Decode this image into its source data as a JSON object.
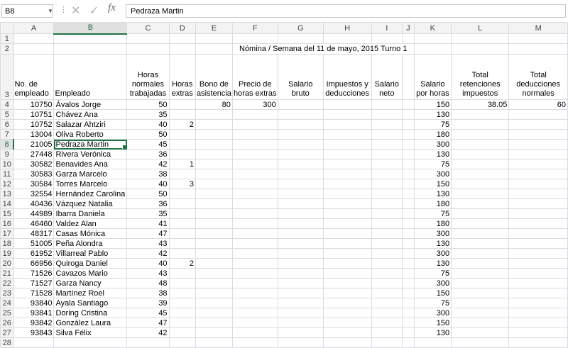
{
  "formula_bar": {
    "name_box": "B8",
    "formula": "Pedraza Martin",
    "fx_label": "fx",
    "dots": "⋮",
    "cancel_icon": "✕",
    "enter_icon": "✓"
  },
  "columns": [
    "A",
    "B",
    "C",
    "D",
    "E",
    "F",
    "G",
    "H",
    "I",
    "J",
    "K",
    "L",
    "M"
  ],
  "title": "Nómina / Semana del 11 de mayo, 2015 Turno 1",
  "headers": {
    "a": "No. de empleado",
    "b": "Empleado",
    "c": "Horas normales trabajadas",
    "d": "Horas extras",
    "e": "Bono de asistencia",
    "f": "Precio de horas extras",
    "g": "Salario bruto",
    "h": "Impuestos y deducciones",
    "i": "Salario neto",
    "k": "Salario por horas",
    "l": "Total retenciones impuestos",
    "m": "Total deducciones normales"
  },
  "rows": [
    {
      "id": "10750",
      "name": "Ávalos Jorge",
      "hours": "50",
      "extra": "",
      "bono": "80",
      "precio": "300",
      "rate": "150",
      "ret": "38.05",
      "ded": "60"
    },
    {
      "id": "10751",
      "name": "Chávez Ana",
      "hours": "35",
      "extra": "",
      "bono": "",
      "precio": "",
      "rate": "130",
      "ret": "",
      "ded": ""
    },
    {
      "id": "10752",
      "name": "Salazar Ahtziri",
      "hours": "40",
      "extra": "2",
      "bono": "",
      "precio": "",
      "rate": "75",
      "ret": "",
      "ded": ""
    },
    {
      "id": "13004",
      "name": "Oliva Roberto",
      "hours": "50",
      "extra": "",
      "bono": "",
      "precio": "",
      "rate": "180",
      "ret": "",
      "ded": ""
    },
    {
      "id": "21005",
      "name": "Pedraza Martin",
      "hours": "45",
      "extra": "",
      "bono": "",
      "precio": "",
      "rate": "300",
      "ret": "",
      "ded": ""
    },
    {
      "id": "27448",
      "name": "Rivera Verónica",
      "hours": "36",
      "extra": "",
      "bono": "",
      "precio": "",
      "rate": "130",
      "ret": "",
      "ded": ""
    },
    {
      "id": "30582",
      "name": "Benavides Ana",
      "hours": "42",
      "extra": "1",
      "bono": "",
      "precio": "",
      "rate": "75",
      "ret": "",
      "ded": ""
    },
    {
      "id": "30583",
      "name": "Garza Marcelo",
      "hours": "38",
      "extra": "",
      "bono": "",
      "precio": "",
      "rate": "300",
      "ret": "",
      "ded": ""
    },
    {
      "id": "30584",
      "name": "Torres Marcelo",
      "hours": "40",
      "extra": "3",
      "bono": "",
      "precio": "",
      "rate": "150",
      "ret": "",
      "ded": ""
    },
    {
      "id": "32554",
      "name": "Hernández Carolina",
      "hours": "50",
      "extra": "",
      "bono": "",
      "precio": "",
      "rate": "130",
      "ret": "",
      "ded": ""
    },
    {
      "id": "40436",
      "name": "Vázquez Natalia",
      "hours": "36",
      "extra": "",
      "bono": "",
      "precio": "",
      "rate": "180",
      "ret": "",
      "ded": ""
    },
    {
      "id": "44989",
      "name": "Ibarra Daniela",
      "hours": "35",
      "extra": "",
      "bono": "",
      "precio": "",
      "rate": "75",
      "ret": "",
      "ded": ""
    },
    {
      "id": "46460",
      "name": "Valdez Alan",
      "hours": "41",
      "extra": "",
      "bono": "",
      "precio": "",
      "rate": "180",
      "ret": "",
      "ded": ""
    },
    {
      "id": "48317",
      "name": "Casas Mónica",
      "hours": "47",
      "extra": "",
      "bono": "",
      "precio": "",
      "rate": "300",
      "ret": "",
      "ded": ""
    },
    {
      "id": "51005",
      "name": "Peña Alondra",
      "hours": "43",
      "extra": "",
      "bono": "",
      "precio": "",
      "rate": "130",
      "ret": "",
      "ded": ""
    },
    {
      "id": "61952",
      "name": "Villarreal Pablo",
      "hours": "42",
      "extra": "",
      "bono": "",
      "precio": "",
      "rate": "300",
      "ret": "",
      "ded": ""
    },
    {
      "id": "66956",
      "name": "Quiroga Daniel",
      "hours": "40",
      "extra": "2",
      "bono": "",
      "precio": "",
      "rate": "130",
      "ret": "",
      "ded": ""
    },
    {
      "id": "71526",
      "name": "Cavazos Mario",
      "hours": "43",
      "extra": "",
      "bono": "",
      "precio": "",
      "rate": "75",
      "ret": "",
      "ded": ""
    },
    {
      "id": "71527",
      "name": "Garza Nancy",
      "hours": "48",
      "extra": "",
      "bono": "",
      "precio": "",
      "rate": "300",
      "ret": "",
      "ded": ""
    },
    {
      "id": "71528",
      "name": "Martínez Roel",
      "hours": "38",
      "extra": "",
      "bono": "",
      "precio": "",
      "rate": "150",
      "ret": "",
      "ded": ""
    },
    {
      "id": "93840",
      "name": "Ayala Santiago",
      "hours": "39",
      "extra": "",
      "bono": "",
      "precio": "",
      "rate": "75",
      "ret": "",
      "ded": ""
    },
    {
      "id": "93841",
      "name": "Doring Cristina",
      "hours": "45",
      "extra": "",
      "bono": "",
      "precio": "",
      "rate": "300",
      "ret": "",
      "ded": ""
    },
    {
      "id": "93842",
      "name": "González Laura",
      "hours": "47",
      "extra": "",
      "bono": "",
      "precio": "",
      "rate": "150",
      "ret": "",
      "ded": ""
    },
    {
      "id": "93843",
      "name": "Silva Félix",
      "hours": "42",
      "extra": "",
      "bono": "",
      "precio": "",
      "rate": "130",
      "ret": "",
      "ded": ""
    }
  ],
  "selection": {
    "row_number": "8",
    "column_letter": "B"
  },
  "colors": {
    "accent": "#217346"
  }
}
